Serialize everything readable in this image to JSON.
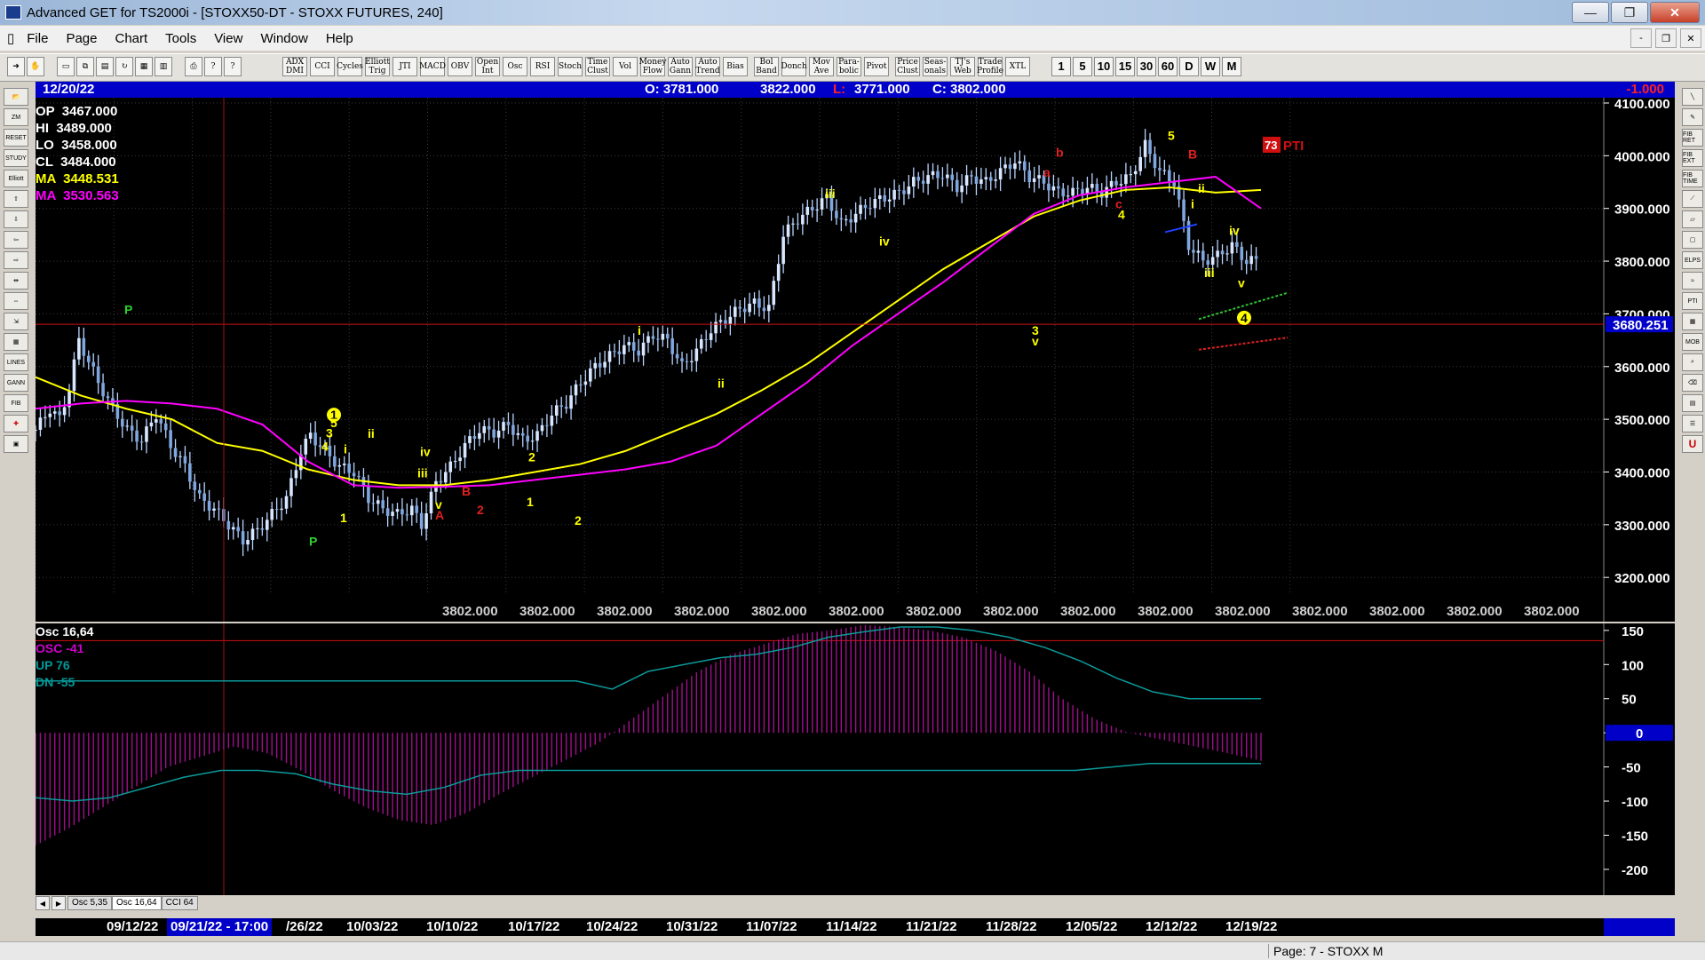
{
  "window": {
    "title": "Advanced GET for TS2000i - [STOXX50-DT - STOXX FUTURES, 240]",
    "min": "—",
    "max": "❐",
    "close": "✕"
  },
  "menu": [
    "File",
    "Page",
    "Chart",
    "Tools",
    "View",
    "Window",
    "Help"
  ],
  "mdi_controls": [
    "-",
    "❐",
    "✕"
  ],
  "toolbar": {
    "studies": [
      "ADX DMI",
      "CCI",
      "Cycles",
      "Elliott Trig",
      "JTI",
      "MACD",
      "OBV",
      "Open Int",
      "Osc",
      "RSI",
      "Stoch",
      "Time Clust",
      "Vol",
      "Money Flow",
      "Auto Gann",
      "Auto Trend",
      "Bias",
      "Bol Band",
      "Donch",
      "Mov Ave",
      "Para-bolic",
      "Pivot",
      "Price Clust",
      "Seas-onals",
      "TJ's Web",
      "Trade Profile",
      "XTL"
    ],
    "timeframes": [
      "1",
      "5",
      "10",
      "15",
      "30",
      "60",
      "D",
      "W",
      "M"
    ]
  },
  "info_bar": {
    "date": "12/20/22",
    "open": "O: 3781.000",
    "high": "3822.000",
    "low_label": "L:",
    "low": "3771.000",
    "close": "C: 3802.000",
    "change": "-1.000"
  },
  "legend": [
    {
      "label": "OP",
      "value": "3467.000",
      "color": "#ffffff"
    },
    {
      "label": "HI",
      "value": "3489.000",
      "color": "#ffffff"
    },
    {
      "label": "LO",
      "value": "3458.000",
      "color": "#ffffff"
    },
    {
      "label": "CL",
      "value": "3484.000",
      "color": "#ffffff"
    },
    {
      "label": "MA",
      "value": "3448.531",
      "color": "#ffff00"
    },
    {
      "label": "MA",
      "value": "3530.563",
      "color": "#ff00ff"
    }
  ],
  "osc_legend": [
    {
      "label": "Osc 16,64",
      "color": "#ffffff"
    },
    {
      "label": "OSC -41",
      "color": "#cc00cc"
    },
    {
      "label": "UP  76",
      "color": "#009999"
    },
    {
      "label": "DN  -55",
      "color": "#009999"
    }
  ],
  "pti": {
    "value": "73",
    "label": "PTI"
  },
  "crosshair_price": "3680.251",
  "price_labels": [
    "3802.000",
    "3802.000",
    "3802.000",
    "3802.000",
    "3802.000",
    "3802.000",
    "3802.000",
    "3802.000",
    "3802.000",
    "3802.000",
    "3802.000",
    "3802.000",
    "3802.000",
    "3802.000",
    "3802.000"
  ],
  "tabs": [
    "Osc 5,35",
    "Osc 16,64",
    "CCI 64"
  ],
  "dates": [
    "09/12/22",
    "09/21/22 - 17:00",
    "/26/22",
    "10/03/22",
    "10/10/22",
    "10/17/22",
    "10/24/22",
    "10/31/22",
    "11/07/22",
    "11/14/22",
    "11/21/22",
    "11/28/22",
    "12/05/22",
    "12/12/22",
    "12/19/22"
  ],
  "status": "Page: 7 - STOXX M",
  "wave_labels": [
    "P",
    "1",
    "5",
    "3",
    "ii",
    "4",
    "i",
    "1",
    "2",
    "P",
    "iv",
    "iii",
    "v",
    "A",
    "B",
    "2",
    "1",
    "2",
    "i",
    "ii",
    "iii",
    "iv",
    "3",
    "v",
    "b",
    "a",
    "c",
    "4",
    "5",
    "B",
    "i",
    "ii",
    "iii",
    "iv",
    "v",
    "4"
  ],
  "chart_data": [
    {
      "type": "candlestick",
      "title": "STOXX50-DT - STOXX FUTURES, 240",
      "y_axis": {
        "range": [
          3170,
          4100
        ],
        "ticks": [
          "3200.000",
          "3300.000",
          "3400.000",
          "3500.000",
          "3600.000",
          "3700.000",
          "3800.000",
          "3900.000",
          "4000.000",
          "4100.000"
        ]
      },
      "x_categories": [
        "09/12/22",
        "09/21/22",
        "09/26/22",
        "10/03/22",
        "10/10/22",
        "10/17/22",
        "10/24/22",
        "10/31/22",
        "11/07/22",
        "11/14/22",
        "11/21/22",
        "11/28/22",
        "12/05/22",
        "12/12/22",
        "12/19/22"
      ],
      "close_path": [
        [
          0,
          3480
        ],
        [
          3,
          3520
        ],
        [
          5,
          3500
        ],
        [
          7,
          3560
        ],
        [
          9,
          3650
        ],
        [
          11,
          3610
        ],
        [
          13,
          3570
        ],
        [
          16,
          3520
        ],
        [
          19,
          3480
        ],
        [
          22,
          3460
        ],
        [
          25,
          3510
        ],
        [
          28,
          3450
        ],
        [
          31,
          3410
        ],
        [
          34,
          3350
        ],
        [
          37,
          3330
        ],
        [
          40,
          3300
        ],
        [
          43,
          3270
        ],
        [
          46,
          3290
        ],
        [
          49,
          3320
        ],
        [
          52,
          3350
        ],
        [
          55,
          3440
        ],
        [
          57,
          3470
        ],
        [
          60,
          3440
        ],
        [
          63,
          3410
        ],
        [
          66,
          3400
        ],
        [
          69,
          3350
        ],
        [
          72,
          3330
        ],
        [
          75,
          3320
        ],
        [
          78,
          3330
        ],
        [
          80,
          3300
        ],
        [
          83,
          3380
        ],
        [
          86,
          3410
        ],
        [
          89,
          3450
        ],
        [
          92,
          3480
        ],
        [
          95,
          3475
        ],
        [
          98,
          3490
        ],
        [
          101,
          3460
        ],
        [
          104,
          3470
        ],
        [
          107,
          3510
        ],
        [
          110,
          3530
        ],
        [
          113,
          3570
        ],
        [
          116,
          3600
        ],
        [
          119,
          3620
        ],
        [
          122,
          3640
        ],
        [
          125,
          3630
        ],
        [
          128,
          3660
        ],
        [
          131,
          3650
        ],
        [
          134,
          3600
        ],
        [
          137,
          3630
        ],
        [
          140,
          3670
        ],
        [
          143,
          3690
        ],
        [
          146,
          3710
        ],
        [
          149,
          3720
        ],
        [
          152,
          3710
        ],
        [
          155,
          3850
        ],
        [
          158,
          3880
        ],
        [
          161,
          3900
        ],
        [
          164,
          3920
        ],
        [
          167,
          3870
        ],
        [
          170,
          3890
        ],
        [
          173,
          3910
        ],
        [
          176,
          3920
        ],
        [
          179,
          3930
        ],
        [
          182,
          3950
        ],
        [
          185,
          3960
        ],
        [
          188,
          3965
        ],
        [
          191,
          3940
        ],
        [
          194,
          3960
        ],
        [
          197,
          3950
        ],
        [
          200,
          3970
        ],
        [
          203,
          3990
        ],
        [
          206,
          3960
        ],
        [
          209,
          3950
        ],
        [
          212,
          3930
        ],
        [
          215,
          3930
        ],
        [
          218,
          3940
        ],
        [
          221,
          3930
        ],
        [
          224,
          3950
        ],
        [
          227,
          3960
        ],
        [
          230,
          4020
        ],
        [
          233,
          3970
        ],
        [
          236,
          3950
        ],
        [
          239,
          3830
        ],
        [
          242,
          3800
        ],
        [
          245,
          3810
        ],
        [
          248,
          3830
        ],
        [
          251,
          3800
        ],
        [
          254,
          3802
        ]
      ],
      "overlays": [
        {
          "name": "MA",
          "color": "#ffff00",
          "values": [
            3580,
            3545,
            3520,
            3500,
            3455,
            3440,
            3405,
            3385,
            3375,
            3375,
            3385,
            3400,
            3415,
            3440,
            3475,
            3510,
            3555,
            3605,
            3665,
            3725,
            3785,
            3835,
            3885,
            3915,
            3935,
            3940,
            3930,
            3935
          ]
        },
        {
          "name": "MA",
          "color": "#ff00ff",
          "values": [
            3520,
            3530,
            3535,
            3530,
            3520,
            3490,
            3420,
            3375,
            3370,
            3372,
            3375,
            3385,
            3395,
            3405,
            3420,
            3450,
            3510,
            3570,
            3640,
            3700,
            3760,
            3825,
            3890,
            3925,
            3940,
            3950,
            3960,
            3900
          ]
        }
      ]
    },
    {
      "type": "bar",
      "title": "Osc 16,64",
      "y_axis": {
        "range": [
          -230,
          155
        ],
        "ticks": [
          "150",
          "100",
          "50",
          "0",
          "-50",
          "-100",
          "-150",
          "-200"
        ]
      },
      "oscillator": [
        -165,
        -140,
        -110,
        -80,
        -50,
        -35,
        -20,
        -30,
        -55,
        -85,
        -110,
        -128,
        -135,
        -118,
        -90,
        -65,
        -40,
        -15,
        20,
        55,
        90,
        115,
        130,
        145,
        150,
        158,
        155,
        150,
        140,
        120,
        90,
        50,
        20,
        0,
        -10,
        -20,
        -30,
        -41
      ],
      "up_line": [
        76,
        76,
        76,
        76,
        76,
        76,
        76,
        76,
        76,
        76,
        76,
        76,
        76,
        76,
        76,
        76,
        64,
        90,
        100,
        110,
        115,
        125,
        140,
        148,
        155,
        155,
        150,
        140,
        125,
        105,
        80,
        60,
        50,
        50,
        50
      ],
      "dn_line": [
        -95,
        -100,
        -95,
        -80,
        -65,
        -55,
        -55,
        -60,
        -75,
        -85,
        -90,
        -80,
        -62,
        -55,
        -55,
        -55,
        -55,
        -55,
        -55,
        -55,
        -55,
        -55,
        -55,
        -55,
        -55,
        -55,
        -55,
        -55,
        -55,
        -50,
        -45,
        -45,
        -45,
        -45
      ]
    }
  ]
}
